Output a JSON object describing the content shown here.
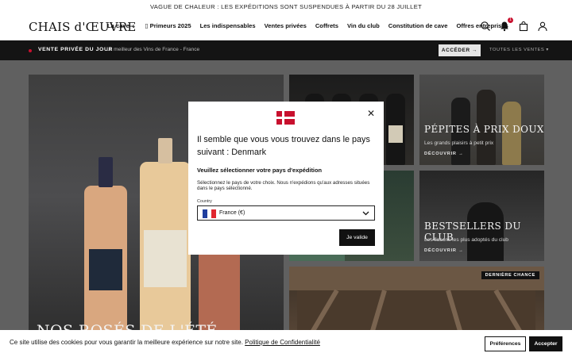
{
  "topbar": {
    "text": "VAGUE DE CHALEUR : LES EXPÉDITIONS SONT SUSPENDUES À PARTIR DU 28 JUILLET"
  },
  "header": {
    "logo": "CHAIS d'ŒUVRE",
    "nav": [
      {
        "label": "La cave ⌄"
      },
      {
        "label": "▯ Primeurs 2025"
      },
      {
        "label": "Les indispensables"
      },
      {
        "label": "Ventes privées"
      },
      {
        "label": "Coffrets"
      },
      {
        "label": "Vin du club"
      },
      {
        "label": "Constitution de cave"
      },
      {
        "label": "Offres entreprises"
      }
    ],
    "cart_badge": "1"
  },
  "promo": {
    "title": "VENTE PRIVÉE DU JOUR",
    "subtitle": "Le meilleur des Vins de France - France",
    "button": "ACCÉDER →",
    "all_sales": "TOUTES LES VENTES ▾"
  },
  "tiles": {
    "big": {
      "title": "NOS ROSÉS DE L'ÉTÉ"
    },
    "b": {
      "title": "PÉPITES À PRIX DOUX",
      "subtitle": "Les grands plaisirs à petit prix",
      "cta": "DÉCOUVRIR →"
    },
    "d": {
      "title": "BESTSELLERS DU CLUB",
      "subtitle": "Les flacons les plus adoptés du club",
      "cta": "DÉCOUVRIR →"
    },
    "e": {
      "badge": "DERNIÈRE CHANCE"
    }
  },
  "modal": {
    "heading": "Il semble que vous vous trouvez dans le pays suivant : Denmark",
    "subheading": "Veuillez sélectionner votre pays d'expédition",
    "paragraph": "Sélectionnez le pays de votre choix. Nous n'expédions qu'aux adresses situées dans le pays sélectionné.",
    "field_label": "Country",
    "selected_country": "France (€)",
    "submit": "Je valide"
  },
  "cookie": {
    "text": "Ce site utilise des cookies pour vous garantir la meilleure expérience sur notre site.",
    "link": "Politique de Confidentialité",
    "preferences": "Préférences",
    "accept": "Accepter"
  },
  "colors": {
    "accent": "#c8102e",
    "dark": "#111111"
  }
}
